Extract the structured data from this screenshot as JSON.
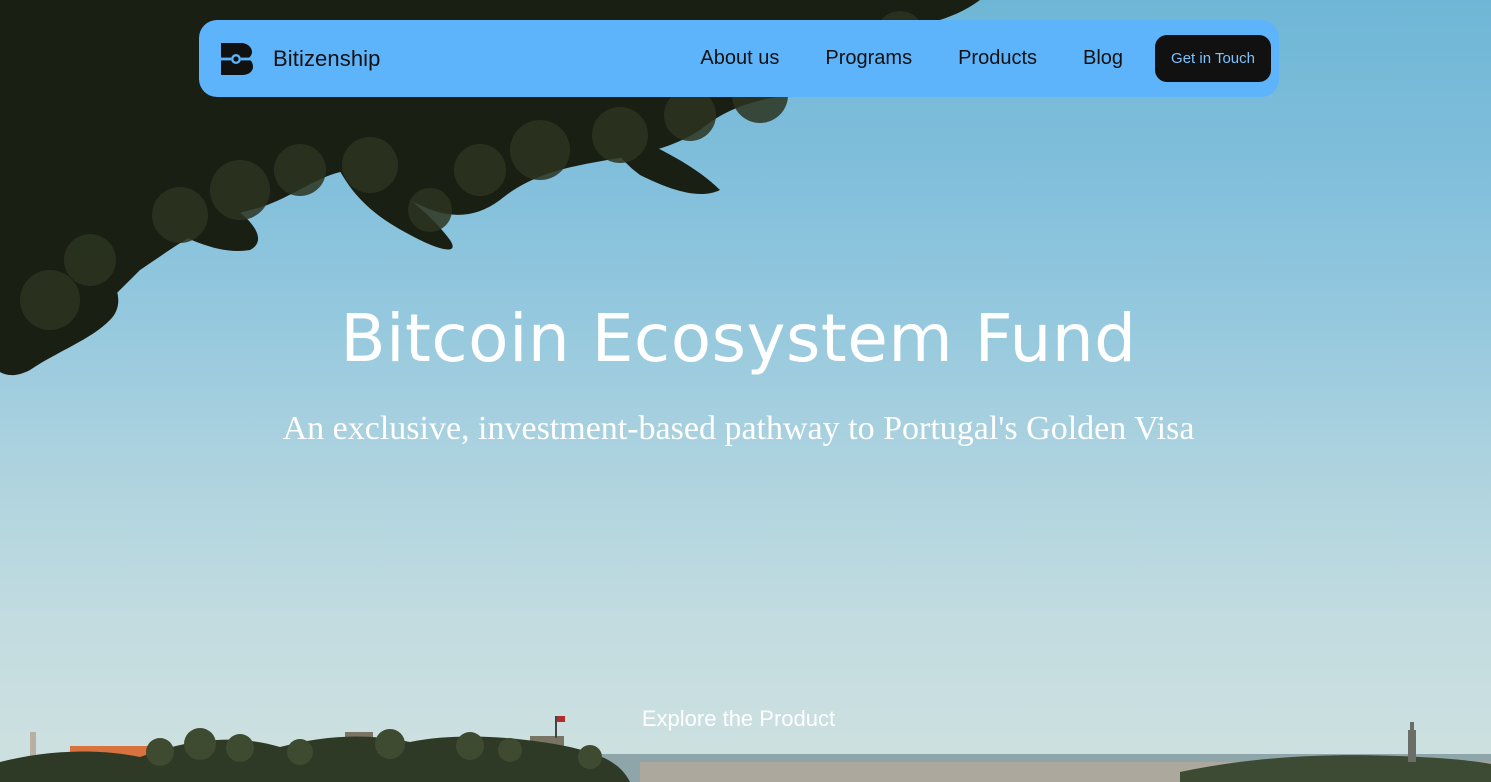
{
  "header": {
    "brand_name": "Bitizenship",
    "brand_icon": "bitizenship-logo",
    "nav": [
      {
        "label": "About us"
      },
      {
        "label": "Programs"
      },
      {
        "label": "Products"
      },
      {
        "label": "Blog"
      }
    ],
    "cta_label": "Get in Touch"
  },
  "hero": {
    "title": "Bitcoin Ecosystem Fund",
    "subtitle": "An exclusive, investment-based pathway to Portugal's Golden Visa",
    "explore_label": "Explore the Product"
  },
  "colors": {
    "navbar_bg": "#5db4fb",
    "cta_bg": "#111111",
    "cta_text": "#7cc2ff",
    "hero_text": "#ffffff",
    "sky_top": "#6fb6d6",
    "sky_bottom": "#cfe1e0"
  }
}
